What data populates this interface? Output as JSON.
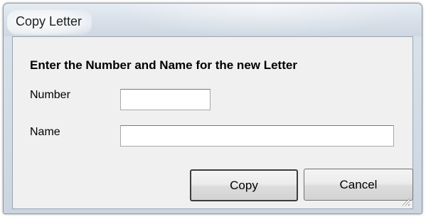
{
  "window": {
    "title": "Copy Letter"
  },
  "form": {
    "heading": "Enter the Number and Name for the new Letter",
    "number_label": "Number",
    "number_value": "",
    "name_label": "Name",
    "name_value": ""
  },
  "buttons": {
    "copy_label": "Copy",
    "cancel_label": "Cancel"
  },
  "icons": {
    "resize_grip": "resize-grip-icon"
  }
}
